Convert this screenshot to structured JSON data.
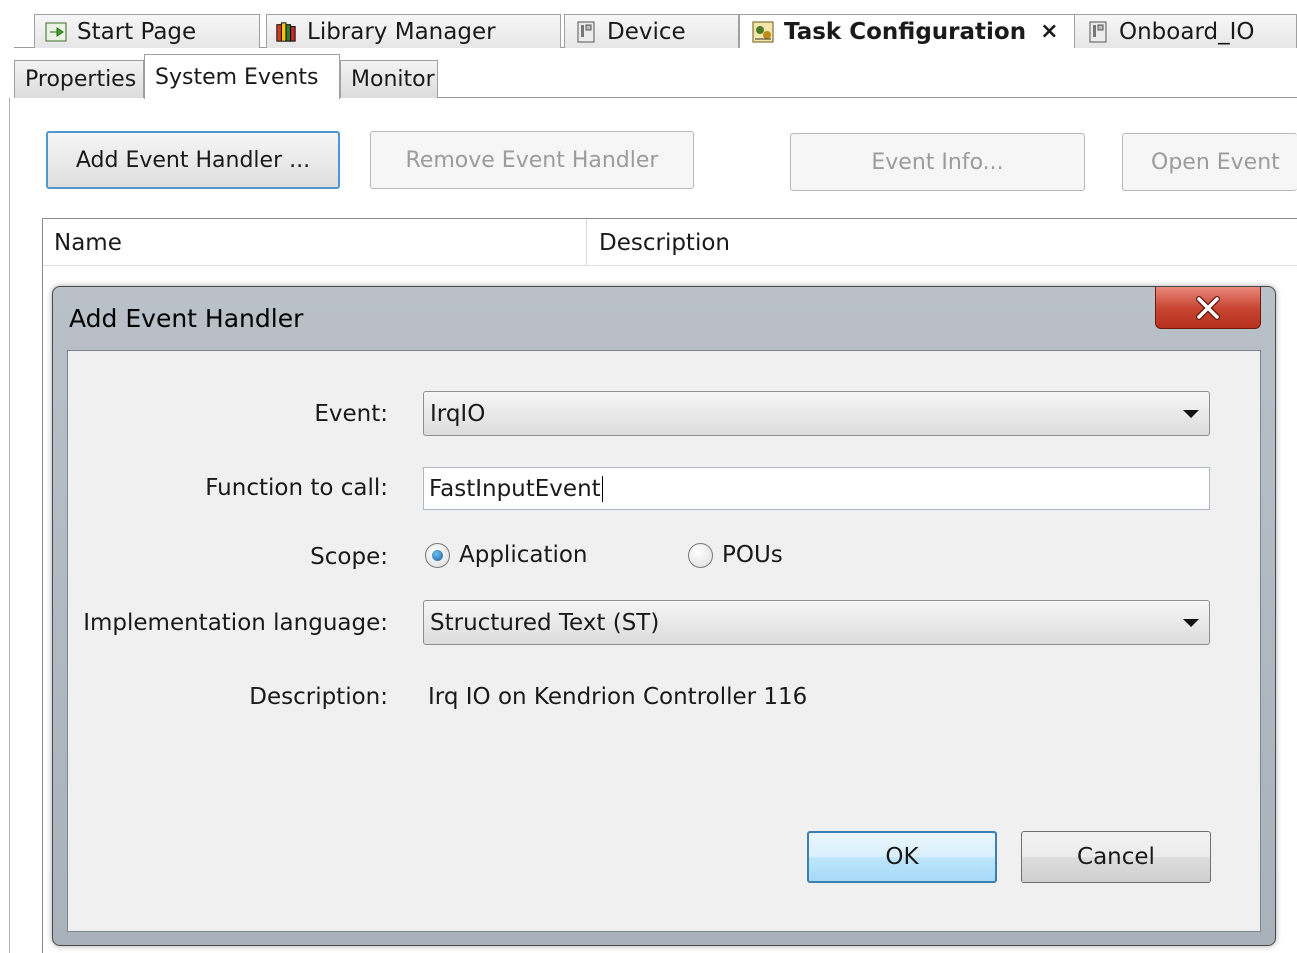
{
  "editor_tabs": [
    {
      "label": "Start Page",
      "icon": "start-page-icon"
    },
    {
      "label": "Library Manager",
      "icon": "library-books-icon"
    },
    {
      "label": "Device",
      "icon": "device-icon"
    },
    {
      "label": "Task Configuration",
      "icon": "task-configuration-icon",
      "active": true,
      "close": "×"
    },
    {
      "label": "Onboard_IO",
      "icon": "device-icon"
    }
  ],
  "sub_tabs": [
    {
      "label": "Properties"
    },
    {
      "label": "System Events",
      "active": true
    },
    {
      "label": "Monitor"
    }
  ],
  "toolbar": {
    "add_event_handler": "Add Event Handler ...",
    "remove_event_handler": "Remove Event Handler",
    "event_info": "Event Info...",
    "open_event": "Open Event"
  },
  "table": {
    "columns": [
      "Name",
      "Description"
    ]
  },
  "dialog": {
    "title": "Add Event Handler",
    "event_label": "Event:",
    "event_value": "IrqIO",
    "function_label": "Function to call:",
    "function_value": "FastInputEvent",
    "scope_label": "Scope:",
    "scope_options": [
      "Application",
      "POUs"
    ],
    "scope_selected": "Application",
    "language_label": "Implementation language:",
    "language_value": "Structured Text (ST)",
    "description_label": "Description:",
    "description_value": "Irq IO on Kendrion Controller 116",
    "ok_label": "OK",
    "cancel_label": "Cancel"
  },
  "colors": {
    "dialog_frame": "#b9c0c8",
    "close_button": "#c6432f",
    "focus_border": "#4f97d1",
    "default_button": "#bee6fd"
  }
}
